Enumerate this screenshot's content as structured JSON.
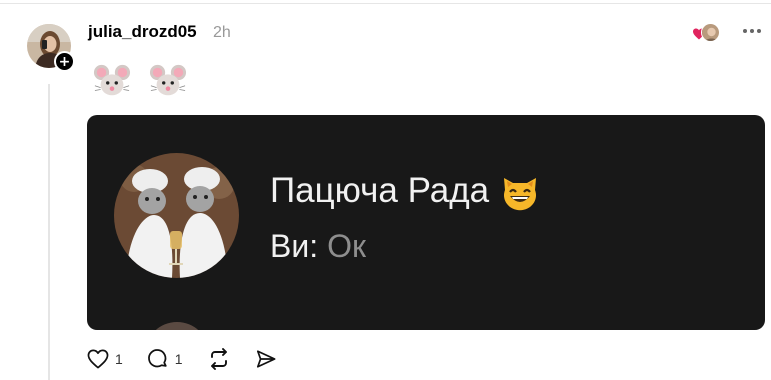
{
  "post": {
    "username": "julia_drozd05",
    "time": "2h",
    "follow_symbol": "+",
    "emojis": [
      "🐭",
      "🐭"
    ]
  },
  "card": {
    "title": "Пацюча Рада",
    "title_emoji": "😸",
    "sub_label": "Ви:",
    "sub_message": "Ок"
  },
  "actions": {
    "like_count": "1",
    "reply_count": "1"
  },
  "icons": {
    "like": "heart-icon",
    "reply": "comment-icon",
    "repost": "repost-icon",
    "share": "send-icon",
    "more": "more-icon"
  },
  "colors": {
    "card_bg": "#181818",
    "heart_reaction": "#e0245e",
    "secondary_text": "#999999"
  }
}
